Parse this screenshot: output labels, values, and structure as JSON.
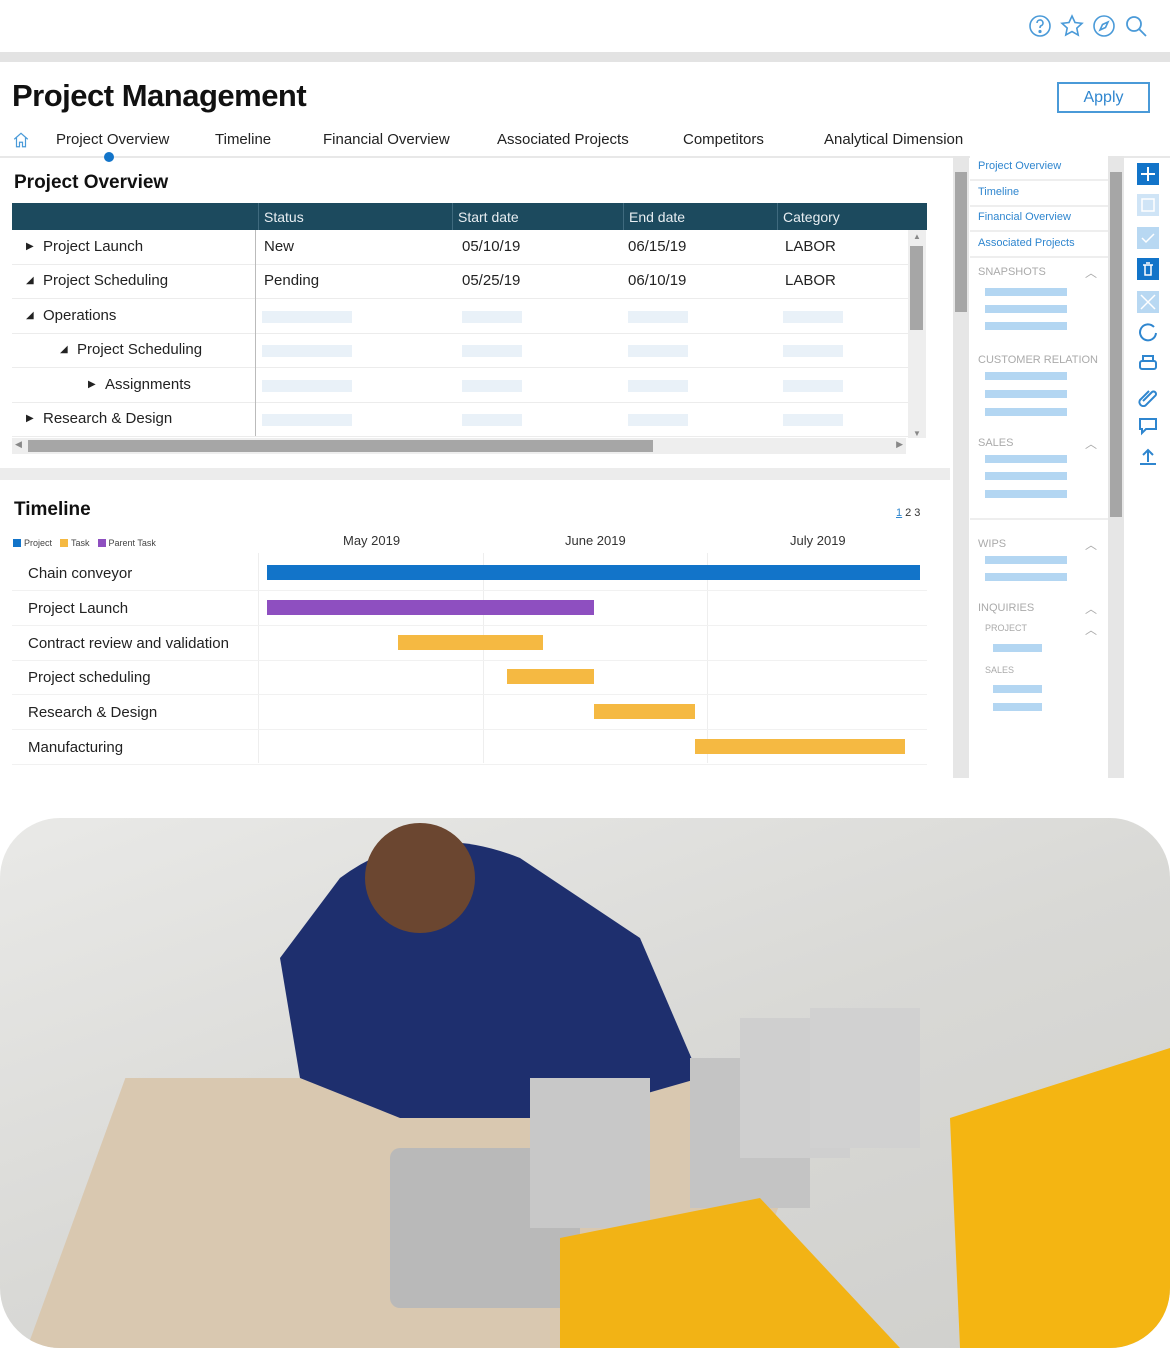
{
  "header": {
    "icons": [
      "help-icon",
      "star-icon",
      "compass-icon",
      "search-icon"
    ],
    "title": "Project Management",
    "apply_label": "Apply"
  },
  "tabs": [
    "Project Overview",
    "Timeline",
    "Financial Overview",
    "Associated Projects",
    "Competitors",
    "Analytical Dimension"
  ],
  "active_tab": "Project Overview",
  "overview": {
    "title": "Project Overview",
    "columns": [
      "",
      "Status",
      "Start date",
      "End date",
      "Category"
    ],
    "rows": [
      {
        "name": "Project Launch",
        "toggle": "collapsed",
        "level": 0,
        "status": "New",
        "start": "05/10/19",
        "end": "06/15/19",
        "category": "LABOR"
      },
      {
        "name": "Project Scheduling",
        "toggle": "expanded",
        "level": 0,
        "status": "Pending",
        "start": "05/25/19",
        "end": "06/10/19",
        "category": "LABOR"
      },
      {
        "name": "Operations",
        "toggle": "expanded",
        "level": 1
      },
      {
        "name": "Project Scheduling",
        "toggle": "expanded",
        "level": 2
      },
      {
        "name": "Assignments",
        "toggle": "collapsed",
        "level": 3
      },
      {
        "name": "Research & Design",
        "toggle": "collapsed",
        "level": 0
      }
    ]
  },
  "timeline": {
    "title": "Timeline",
    "pages": [
      "1",
      "2",
      "3"
    ],
    "current_page": "1",
    "legend": [
      {
        "label": "Project",
        "color": "#1274c9"
      },
      {
        "label": "Task",
        "color": "#f5b942"
      },
      {
        "label": "Parent Task",
        "color": "#8e4fc0"
      }
    ],
    "months": [
      "May 2019",
      "June 2019",
      "July 2019"
    ],
    "tasks": [
      {
        "name": "Chain conveyor",
        "type": "Project",
        "start": "2019-05-02",
        "end": "2019-07-31"
      },
      {
        "name": "Project Launch",
        "type": "Parent Task",
        "start": "2019-05-02",
        "end": "2019-06-16"
      },
      {
        "name": "Contract review and validation",
        "type": "Task",
        "start": "2019-05-20",
        "end": "2019-06-09"
      },
      {
        "name": "Project scheduling",
        "type": "Task",
        "start": "2019-06-04",
        "end": "2019-06-16"
      },
      {
        "name": "Research & Design",
        "type": "Task",
        "start": "2019-06-16",
        "end": "2019-06-30"
      },
      {
        "name": "Manufacturing",
        "type": "Task",
        "start": "2019-06-30",
        "end": "2019-07-29"
      }
    ]
  },
  "sidebar": {
    "links": [
      "Project Overview",
      "Timeline",
      "Financial Overview",
      "Associated Projects"
    ],
    "sections": [
      {
        "label": "SNAPSHOTS",
        "collapsible": true
      },
      {
        "label": "CUSTOMER RELATION",
        "collapsible": false
      },
      {
        "label": "SALES",
        "collapsible": true
      },
      {
        "label": "WIPS",
        "collapsible": true
      },
      {
        "label": "INQUIRIES",
        "collapsible": true
      },
      {
        "label": "PROJECT",
        "collapsible": true
      },
      {
        "label": "SALES",
        "collapsible": false
      }
    ]
  },
  "toolbar": [
    "add-icon",
    "save-icon",
    "check-icon",
    "trash-icon",
    "close-icon",
    "refresh-icon",
    "print-icon",
    "attach-icon",
    "comment-icon",
    "upload-icon"
  ],
  "colors": {
    "accent": "#1274c9",
    "header": "#1c4a5e",
    "link": "#2f86cf"
  },
  "photo": {
    "description_icon": "photo"
  }
}
